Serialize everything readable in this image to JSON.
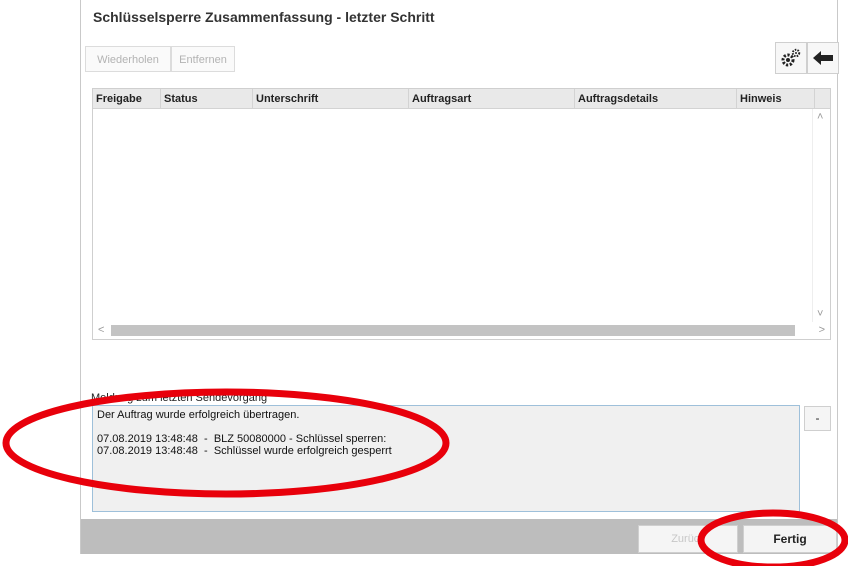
{
  "window": {
    "title": "Schlüsselsperre Zusammenfassung - letzter Schritt"
  },
  "toolbar": {
    "repeat_label": "Wiederholen",
    "remove_label": "Entfernen"
  },
  "icons": {
    "settings": "gears-icon",
    "back": "arrow-left-icon"
  },
  "table": {
    "columns": [
      "Freigabe",
      "Status",
      "Unterschrift",
      "Auftragsart",
      "Auftragsdetails",
      "Hinweis"
    ],
    "rows": []
  },
  "message": {
    "label": "Meldung zum letzten Sendevorgang",
    "lines": [
      "Der Auftrag wurde erfolgreich übertragen.",
      "",
      "07.08.2019 13:48:48  -  BLZ 50080000 - Schlüssel sperren:",
      "07.08.2019 13:48:48  -  Schlüssel wurde erfolgreich gesperrt"
    ],
    "collapse_label": "-"
  },
  "footer": {
    "back_label": "Zurück",
    "done_label": "Fertig"
  },
  "colors": {
    "annotation": "#e8000b",
    "footer": "#bdbdbd",
    "message_border": "#9ec0da"
  }
}
